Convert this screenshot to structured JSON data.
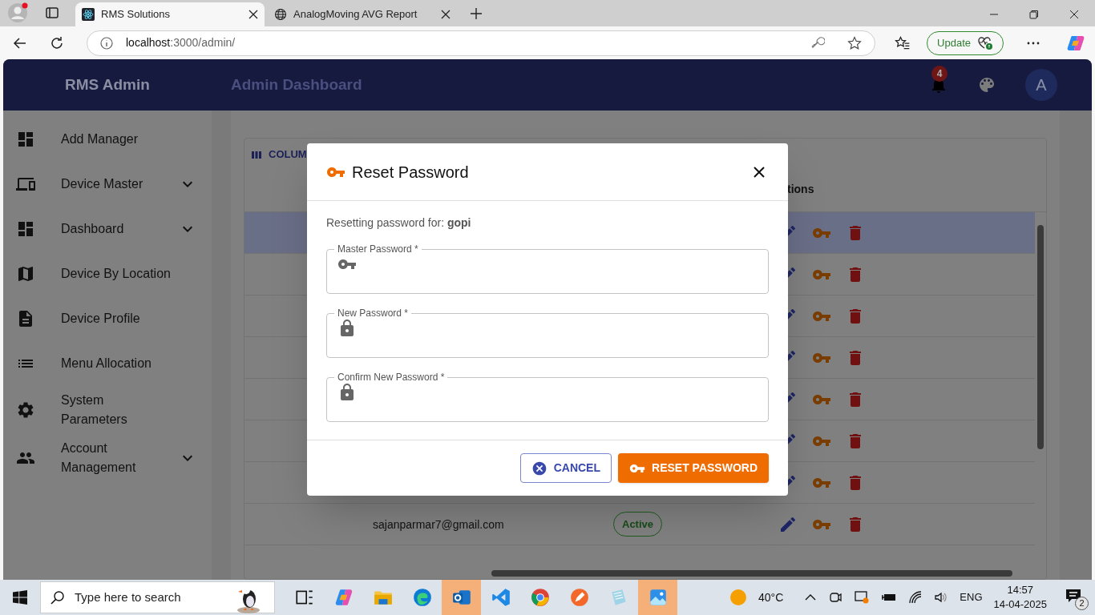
{
  "browser": {
    "tabs": [
      {
        "title": "RMS Solutions",
        "selected": true
      },
      {
        "title": "AnalogMoving AVG Report",
        "selected": false
      }
    ],
    "address": {
      "host": "localhost",
      "path": ":3000/admin/"
    },
    "update_button": "Update"
  },
  "app": {
    "brand": "RMS Admin",
    "page_title": "Admin Dashboard",
    "notification_count": "4",
    "avatar_initial": "A"
  },
  "sidebar": {
    "items": [
      {
        "label": "Add Manager",
        "has_submenu": false
      },
      {
        "label": "Device Master",
        "has_submenu": true
      },
      {
        "label": "Dashboard",
        "has_submenu": true
      },
      {
        "label": "Device By Location",
        "has_submenu": false
      },
      {
        "label": "Device Profile",
        "has_submenu": false
      },
      {
        "label": "Menu Allocation",
        "has_submenu": false
      },
      {
        "label": "System Parameters",
        "has_submenu": false
      },
      {
        "label": "Account Management",
        "has_submenu": true
      }
    ]
  },
  "table": {
    "toolbar_button": "COLUM",
    "columns": [
      {
        "label": "tions"
      }
    ],
    "rows": [
      {
        "selected": true
      },
      {
        "selected": false
      },
      {
        "selected": false
      },
      {
        "selected": false
      },
      {
        "selected": false
      },
      {
        "selected": false
      },
      {
        "selected": false
      },
      {
        "email": "sajanparmar7@gmail.com",
        "status": "Active",
        "selected": false
      }
    ]
  },
  "dialog": {
    "title": "Reset Password",
    "subtitle": "Resetting password for: **gopi**",
    "fields": [
      {
        "label": "Master Password *",
        "kind": "key"
      },
      {
        "label": "New Password *",
        "kind": "lock"
      },
      {
        "label": "Confirm New Password *",
        "kind": "lock"
      }
    ],
    "cancel_button": "CANCEL",
    "submit_button": "RESET PASSWORD"
  },
  "taskbar": {
    "search_placeholder": "Type here to search",
    "apps": [
      {
        "active": false
      },
      {
        "active": false
      },
      {
        "active": false
      },
      {
        "active": false
      },
      {
        "active": true
      },
      {
        "active": false
      },
      {
        "active": false
      },
      {
        "active": false
      },
      {
        "active": false
      },
      {
        "active": true
      }
    ],
    "weather": "40°C",
    "language": "ENG",
    "time": "14:57",
    "date": "14-04-2025",
    "notification_count": "2"
  }
}
